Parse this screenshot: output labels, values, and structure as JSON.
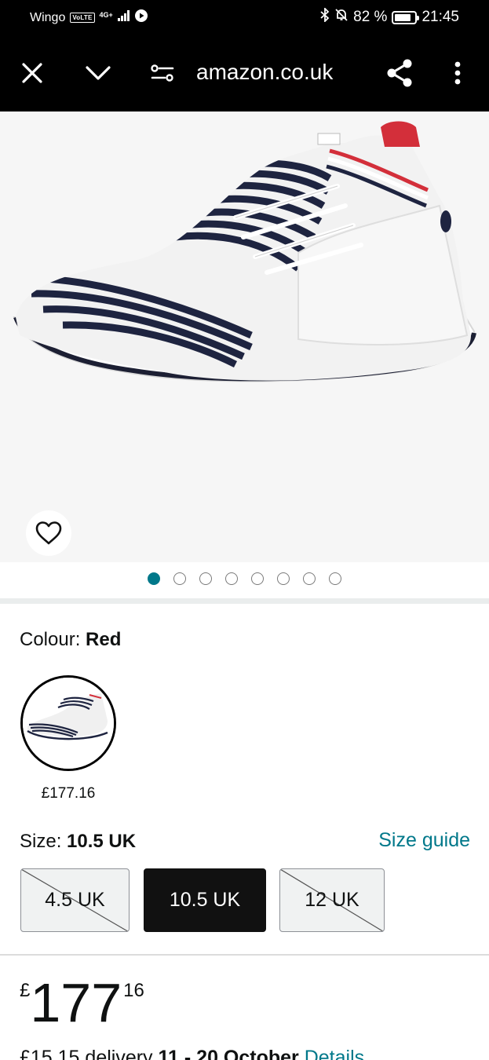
{
  "status_bar": {
    "carrier": "Wingo",
    "volte": "VoLTE",
    "network": "4G+",
    "battery_percent": "82 %",
    "battery_level": 0.82,
    "time": "21:45"
  },
  "browser": {
    "url": "amazon.co.uk",
    "icons": [
      "close-icon",
      "chevron-down-icon",
      "site-settings-icon",
      "share-icon",
      "more-vert-icon"
    ]
  },
  "gallery": {
    "total_images": 8,
    "active_index": 0,
    "wishlist_icon": "heart-outline-icon"
  },
  "colour": {
    "label": "Colour: ",
    "value": "Red",
    "swatch_price": "£177.16"
  },
  "size": {
    "label": "Size: ",
    "value": "10.5 UK",
    "guide_link": "Size guide",
    "options": [
      {
        "label": "4.5 UK",
        "available": false,
        "selected": false
      },
      {
        "label": "10.5 UK",
        "available": true,
        "selected": true
      },
      {
        "label": "12 UK",
        "available": false,
        "selected": false
      }
    ]
  },
  "price": {
    "currency": "£",
    "whole": "177",
    "fraction": "16"
  },
  "delivery": {
    "cost": "£15.15 delivery ",
    "dates": "11 - 20 October",
    "details_link": "Details"
  },
  "colors": {
    "accent": "#00788a",
    "toolbar": "#000000"
  }
}
